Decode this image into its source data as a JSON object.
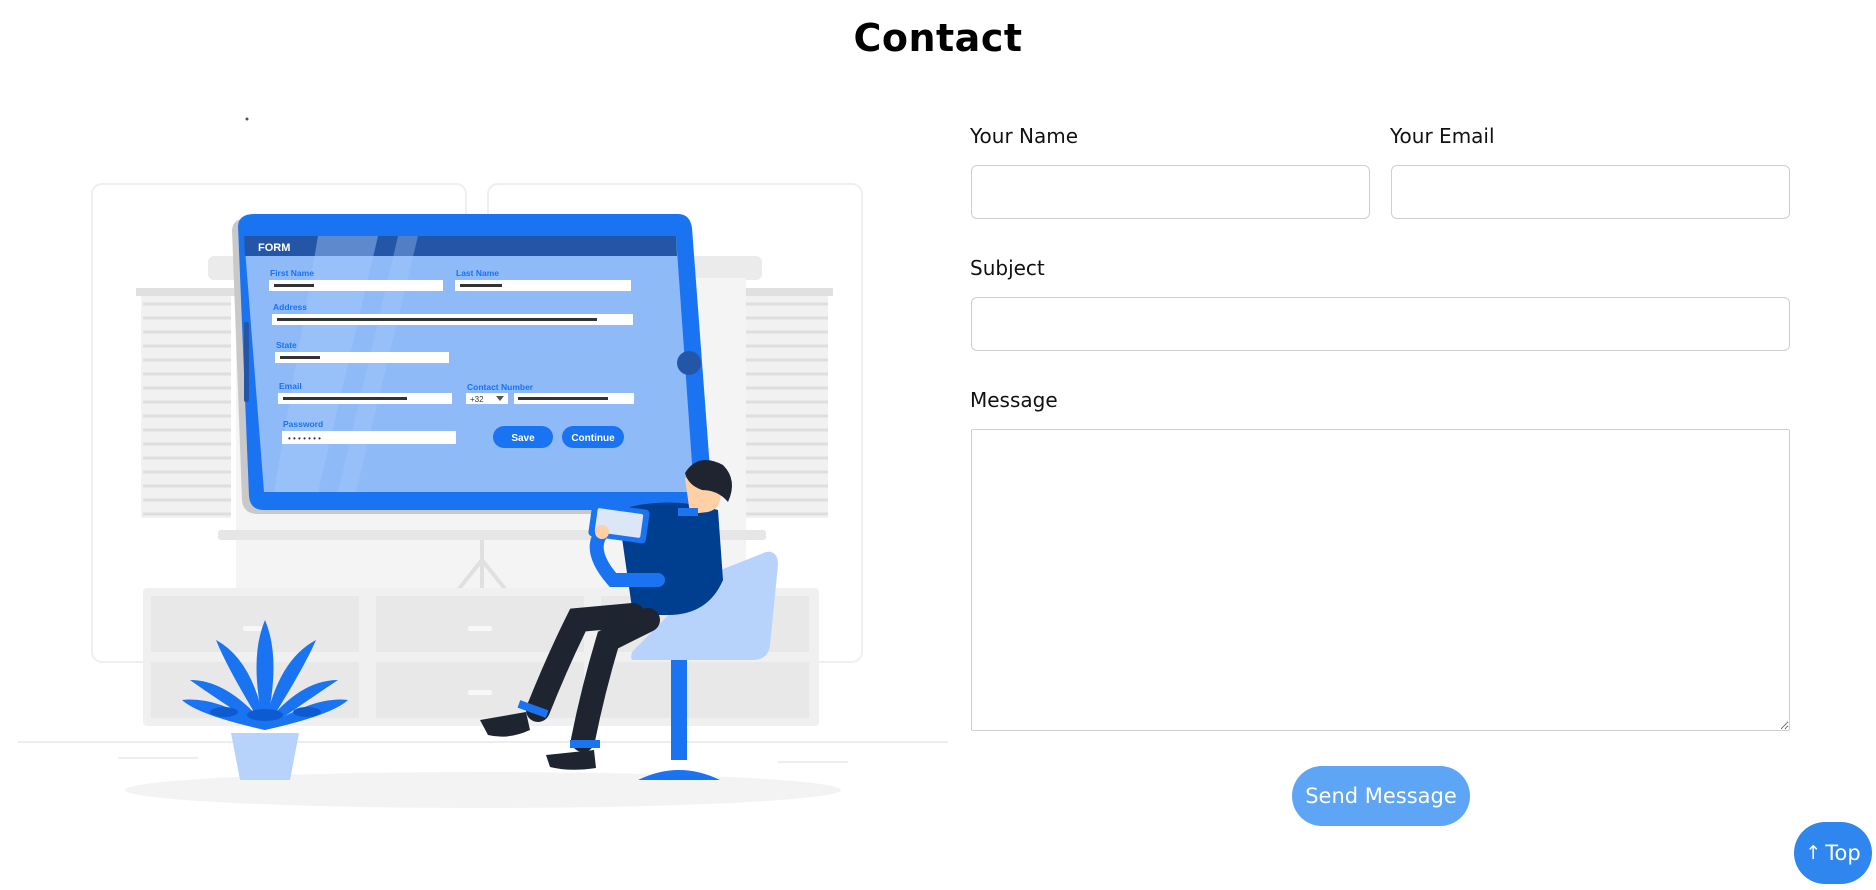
{
  "page": {
    "title": "Contact"
  },
  "illustration": {
    "screen_header": "FORM",
    "labels": {
      "first_name": "First Name",
      "last_name": "Last Name",
      "address": "Address",
      "state": "State",
      "email": "Email",
      "contact_number": "Contact Number",
      "password": "Password",
      "country_code": "+32",
      "password_dots": "• • • • • • •"
    },
    "buttons": {
      "save": "Save",
      "continue": "Continue"
    }
  },
  "form": {
    "name_label": "Your Name",
    "name_value": "",
    "email_label": "Your Email",
    "email_value": "",
    "subject_label": "Subject",
    "subject_value": "",
    "message_label": "Message",
    "message_value": "",
    "submit_label": "Send Message"
  },
  "scroll_top": {
    "arrow": "↑",
    "label": "Top"
  },
  "colors": {
    "primary_blue": "#2f86ee",
    "send_button": "#5ea6f5",
    "illustration_blue": "#1a73f0",
    "illustration_light_blue": "#8fbaf8"
  }
}
